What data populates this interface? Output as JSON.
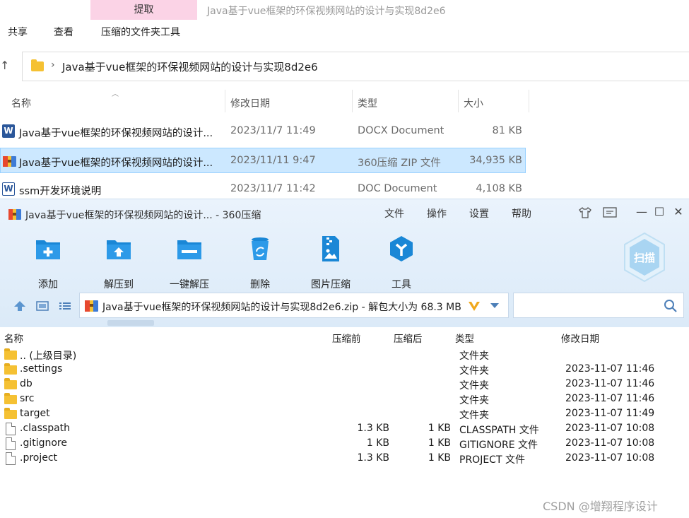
{
  "explorer": {
    "context_tab": "提取",
    "title": "Java基于vue框架的环保视频网站的设计与实现8d2e6",
    "ribbon_tabs": [
      "共享",
      "查看",
      "压缩的文件夹工具"
    ],
    "address": "Java基于vue框架的环保视频网站的设计与实现8d2e6",
    "columns": {
      "name": "名称",
      "modified": "修改日期",
      "type": "类型",
      "size": "大小"
    },
    "rows": [
      {
        "name": "Java基于vue框架的环保视频网站的设计...",
        "modified": "2023/11/7 11:49",
        "type": "DOCX Document",
        "size": "81 KB",
        "icon": "word-docx-icon",
        "selected": false
      },
      {
        "name": "Java基于vue框架的环保视频网站的设计...",
        "modified": "2023/11/11 9:47",
        "type": "360压缩 ZIP 文件",
        "size": "34,935 KB",
        "icon": "zip-archive-icon",
        "selected": true
      },
      {
        "name": "ssm开发环境说明",
        "modified": "2023/11/7 11:42",
        "type": "DOC Document",
        "size": "4,108 KB",
        "icon": "word-doc-icon",
        "selected": false
      }
    ]
  },
  "zip": {
    "title": "Java基于vue框架的环保视频网站的设计... - 360压缩",
    "menu": [
      "文件",
      "操作",
      "设置",
      "帮助"
    ],
    "tools": [
      "添加",
      "解压到",
      "一键解压",
      "删除",
      "图片压缩",
      "工具"
    ],
    "scan_label": "扫描",
    "address": "Java基于vue框架的环保视频网站的设计与实现8d2e6.zip - 解包大小为 68.3 MB",
    "columns": {
      "name": "名称",
      "before": "压缩前",
      "after": "压缩后",
      "type": "类型",
      "modified": "修改日期"
    },
    "rows": [
      {
        "name": ".. (上级目录)",
        "before": "",
        "after": "",
        "type": "文件夹",
        "modified": "",
        "kind": "folder"
      },
      {
        "name": ".settings",
        "before": "",
        "after": "",
        "type": "文件夹",
        "modified": "2023-11-07 11:46",
        "kind": "folder"
      },
      {
        "name": "db",
        "before": "",
        "after": "",
        "type": "文件夹",
        "modified": "2023-11-07 11:46",
        "kind": "folder"
      },
      {
        "name": "src",
        "before": "",
        "after": "",
        "type": "文件夹",
        "modified": "2023-11-07 11:46",
        "kind": "folder"
      },
      {
        "name": "target",
        "before": "",
        "after": "",
        "type": "文件夹",
        "modified": "2023-11-07 11:49",
        "kind": "folder"
      },
      {
        "name": ".classpath",
        "before": "1.3 KB",
        "after": "1 KB",
        "type": "CLASSPATH 文件",
        "modified": "2023-11-07 10:08",
        "kind": "file"
      },
      {
        "name": ".gitignore",
        "before": "1 KB",
        "after": "1 KB",
        "type": "GITIGNORE 文件",
        "modified": "2023-11-07 10:08",
        "kind": "file"
      },
      {
        "name": ".project",
        "before": "1.3 KB",
        "after": "1 KB",
        "type": "PROJECT 文件",
        "modified": "2023-11-07 10:08",
        "kind": "file"
      }
    ]
  },
  "watermark": "CSDN @增翔程序设计"
}
